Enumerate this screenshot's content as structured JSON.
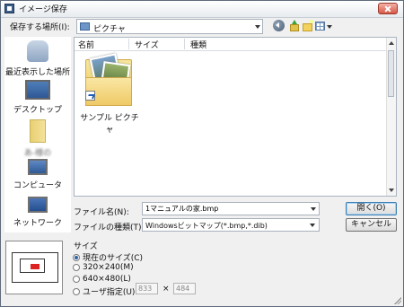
{
  "window": {
    "title": "イメージ保存"
  },
  "lookin": {
    "label": "保存する場所(I):",
    "value": "ピクチャ"
  },
  "places": [
    {
      "label": "最近表示した場所",
      "icon": "recent-places-icon"
    },
    {
      "label": "デスクトップ",
      "icon": "desktop-icon"
    },
    {
      "label": "あ-様の",
      "icon": "user-documents-icon",
      "blurred": true
    },
    {
      "label": "コンピュータ",
      "icon": "computer-icon"
    },
    {
      "label": "ネットワーク",
      "icon": "network-icon"
    }
  ],
  "filelist": {
    "columns": [
      "名前",
      "サイズ",
      "種類"
    ],
    "items": [
      {
        "name": "サンプル ピクチャ",
        "icon": "folder-shortcut-icon"
      }
    ]
  },
  "filename": {
    "label": "ファイル名(N):",
    "value": "1マニュアルの家.bmp"
  },
  "filetype": {
    "label": "ファイルの種類(T):",
    "value": "Windowsビットマップ(*.bmp,*.dib)"
  },
  "buttons": {
    "open": "開く(O)",
    "cancel": "キャンセル"
  },
  "size": {
    "title": "サイズ",
    "options": [
      {
        "label": "現在のサイズ(C)",
        "checked": true
      },
      {
        "label": "320×240(M)",
        "checked": false
      },
      {
        "label": "640×480(L)",
        "checked": false
      },
      {
        "label": "ユーザ指定(U)",
        "checked": false
      }
    ],
    "width": "833",
    "times": "×",
    "height": "484"
  }
}
